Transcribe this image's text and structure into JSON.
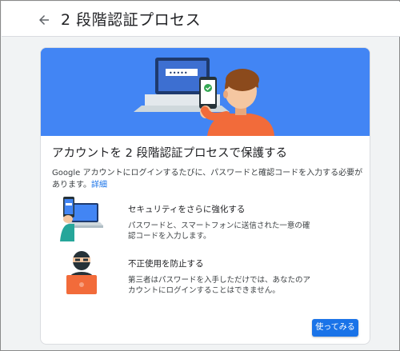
{
  "header": {
    "back_icon": "arrow-left-icon",
    "title": "2 段階認証プロセス"
  },
  "card": {
    "heading": "アカウントを 2 段階認証プロセスで保護する",
    "description": "Google アカウントにログインするたびに、パスワードと確認コードを入力する必要があります。",
    "details_link": "詳細",
    "features": [
      {
        "icon": "phone-laptop-icon",
        "title": "セキュリティをさらに強化する",
        "description": "パスワードと、スマートフォンに送信された一意の確認コードを入力します。"
      },
      {
        "icon": "masked-intruder-icon",
        "title": "不正使用を防止する",
        "description": "第三者はパスワードを入手しただけでは、あなたのアカウントにログインすることはできません。"
      }
    ],
    "button_label": "使ってみる"
  },
  "hero": {
    "illustration": "person-with-phone-and-laptop-illustration",
    "password_mask": "•••••"
  },
  "colors": {
    "hero_bg": "#4285f4",
    "accent": "#1a73e8",
    "check": "#34a853",
    "orange": "#f26b3a"
  }
}
